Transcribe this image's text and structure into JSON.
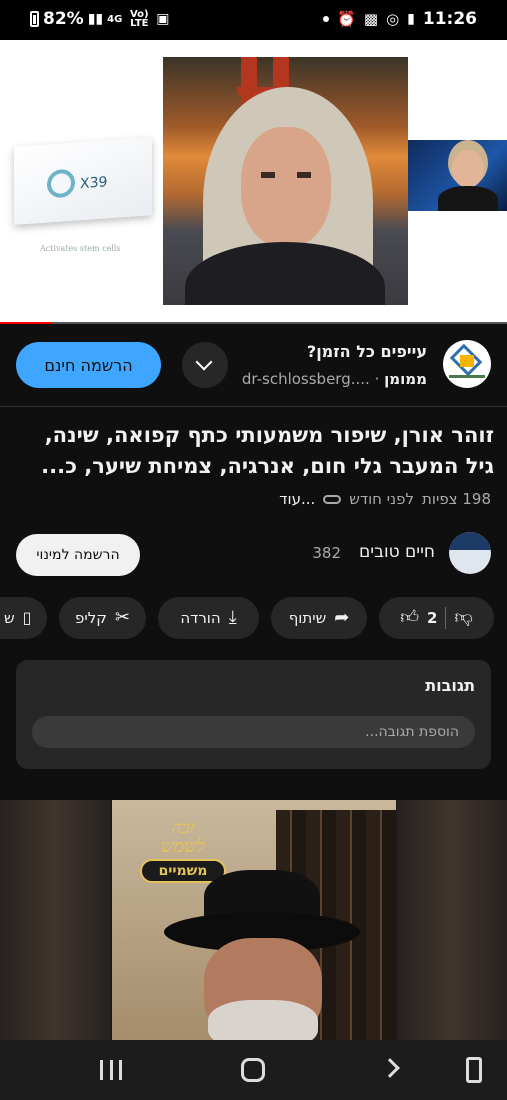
{
  "status_bar": {
    "battery": "82%",
    "network": "4G",
    "volte": "Vo) LTE",
    "time": "11:26"
  },
  "video": {
    "product_name": "X39",
    "product_caption": "Activates stem cells",
    "progress_fraction": 0.1
  },
  "channel": {
    "title": "עייפים כל הזמן?",
    "sponsored_label": "ממומן",
    "domain": "dr-schlossberg....",
    "join_label": "הרשמה חינם"
  },
  "video_info": {
    "title": "זוהר אורן, שיפור משמעותי כתף קפואה, שינה, גיל המעבר גלי חום, אנרגיה, צמיחת שיער, כ...",
    "views": "198 צפיות",
    "age": "לפני חודש",
    "more": "...עוד"
  },
  "poster": {
    "name": "חיים טובים",
    "subscribers": "382",
    "subscribe_label": "הרשמה למינוי"
  },
  "actions": {
    "likes": "2",
    "share": "שיתוף",
    "download": "הורדה",
    "clip": "קליפ",
    "save": "ש"
  },
  "comments": {
    "title": "תגובות",
    "placeholder": "הוספת תגובה..."
  },
  "next_video": {
    "badge_line1": "זכה",
    "badge_line2": "לשמש",
    "badge_line3": "משמיים"
  }
}
